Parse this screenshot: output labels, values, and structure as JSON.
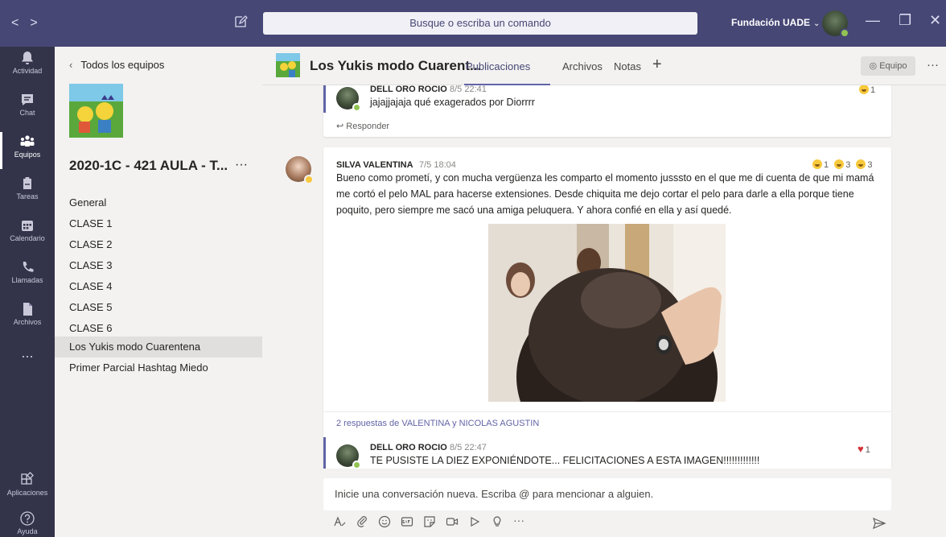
{
  "titlebar": {
    "nav_back": "<",
    "nav_forward": ">",
    "search_placeholder": "Busque o escriba un comando",
    "org_name": "Fundación UADE",
    "org_chevron": "⌄",
    "minimize": "—",
    "maximize": "❐",
    "close": "✕"
  },
  "rail": {
    "items": [
      {
        "label": "Actividad",
        "icon": "bell-icon"
      },
      {
        "label": "Chat",
        "icon": "chat-icon"
      },
      {
        "label": "Equipos",
        "icon": "teams-icon"
      },
      {
        "label": "Tareas",
        "icon": "assignments-icon"
      },
      {
        "label": "Calendario",
        "icon": "calendar-icon"
      },
      {
        "label": "Llamadas",
        "icon": "phone-icon"
      },
      {
        "label": "Archivos",
        "icon": "files-icon"
      },
      {
        "label": "...",
        "icon": "more-icon"
      }
    ],
    "apps_label": "Aplicaciones",
    "help_label": "Ayuda"
  },
  "team": {
    "back_label": "Todos los equipos",
    "name": "2020-1C - 421 AULA - T...",
    "more": "···",
    "channels": [
      "General",
      "CLASE 1",
      "CLASE 2",
      "CLASE 3",
      "CLASE 4",
      "CLASE 5",
      "CLASE 6",
      "Los Yukis modo Cuarentena",
      "Primer Parcial Hashtag Miedo"
    ],
    "selected_channel": "Los Yukis modo Cuarentena"
  },
  "channel_header": {
    "title": "Los Yukis modo Cuarent...",
    "tabs": [
      "Publicaciones",
      "Archivos",
      "Notas"
    ],
    "active_tab": "Publicaciones",
    "add_tab": "+",
    "team_button": "Equipo",
    "more": "···"
  },
  "feed": {
    "top_reply": {
      "author": "DELL ORO ROCIO",
      "time": "8/5 22:41",
      "text": "jajajjajaja qué exagerados por Diorrrr",
      "reaction_count": "1",
      "respond_label": "Responder"
    },
    "post": {
      "author": "SILVA VALENTINA",
      "time": "7/5 18:04",
      "text": "Bueno como prometí, y con mucha vergüenza les comparto el momento jusssto en el que me di cuenta de que mi mamá me cortó el pelo MAL para hacerse extensiones. Desde chiquita me dejo cortar el pelo para darle a ella porque tiene poquito, pero siempre me sacó una amiga peluquera. Y ahora confié en ella y así quedé.",
      "reactions": [
        "1",
        "3",
        "3"
      ],
      "replies_summary": "2 respuestas de VALENTINA y NICOLAS AGUSTIN"
    },
    "bottom_reply": {
      "author": "DELL ORO ROCIO",
      "time": "8/5 22:47",
      "text": "TE PUSISTE LA DIEZ EXPONIÉNDOTE... FELICITACIONES A ESTA IMAGEN!!!!!!!!!!!!!",
      "reaction_count": "1"
    }
  },
  "compose": {
    "placeholder": "Inicie una conversación nueva. Escriba @ para mencionar a alguien.",
    "toolbar_icons": [
      "format-icon",
      "attach-icon",
      "emoji-icon",
      "gif-icon",
      "sticker-icon",
      "meet-icon",
      "stream-icon",
      "praise-icon",
      "more-icon"
    ]
  },
  "colors": {
    "titlebar": "#464775",
    "rail": "#33344a",
    "accent": "#6264a7",
    "panel": "#f3f2f1"
  }
}
